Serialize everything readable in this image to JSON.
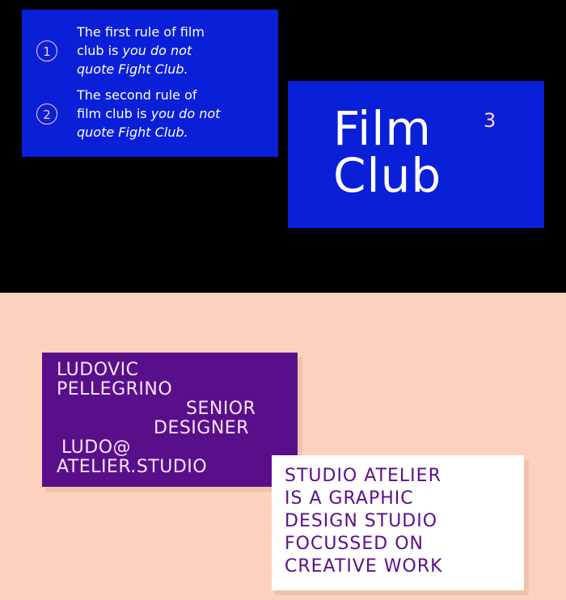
{
  "rules": [
    {
      "number": "1",
      "line1": "The first rule of film",
      "line2_plain": "club is ",
      "line2_em": "you do not",
      "line3_em": "quote Fight Club."
    },
    {
      "number": "2",
      "line1": "The second rule of",
      "line2_plain": "film club is ",
      "line2_em": "you do not",
      "line3_em": "quote Fight Club."
    }
  ],
  "film_card": {
    "line1": "Film",
    "line2": "Club",
    "superscript": "3"
  },
  "person_card": {
    "first_name": "LUDOVIC",
    "last_name": "PELLEGRINO",
    "title_line1": "SENIOR",
    "title_line2": "DESIGNER",
    "email_line1": "LUDO@",
    "email_line2": "ATELIER.STUDIO"
  },
  "studio_card": {
    "lines": [
      "STUDIO ATELIER",
      "IS A GRAPHIC",
      "DESIGN STUDIO",
      "FOCUSSED ON",
      "CREATIVE WORK"
    ]
  },
  "colors": {
    "top_background": "#000000",
    "bottom_background": "#fdd2bd",
    "blue_card": "#0a1fd8",
    "purple_card": "#5a0f8a",
    "accent_peach": "#ffd6c6"
  }
}
